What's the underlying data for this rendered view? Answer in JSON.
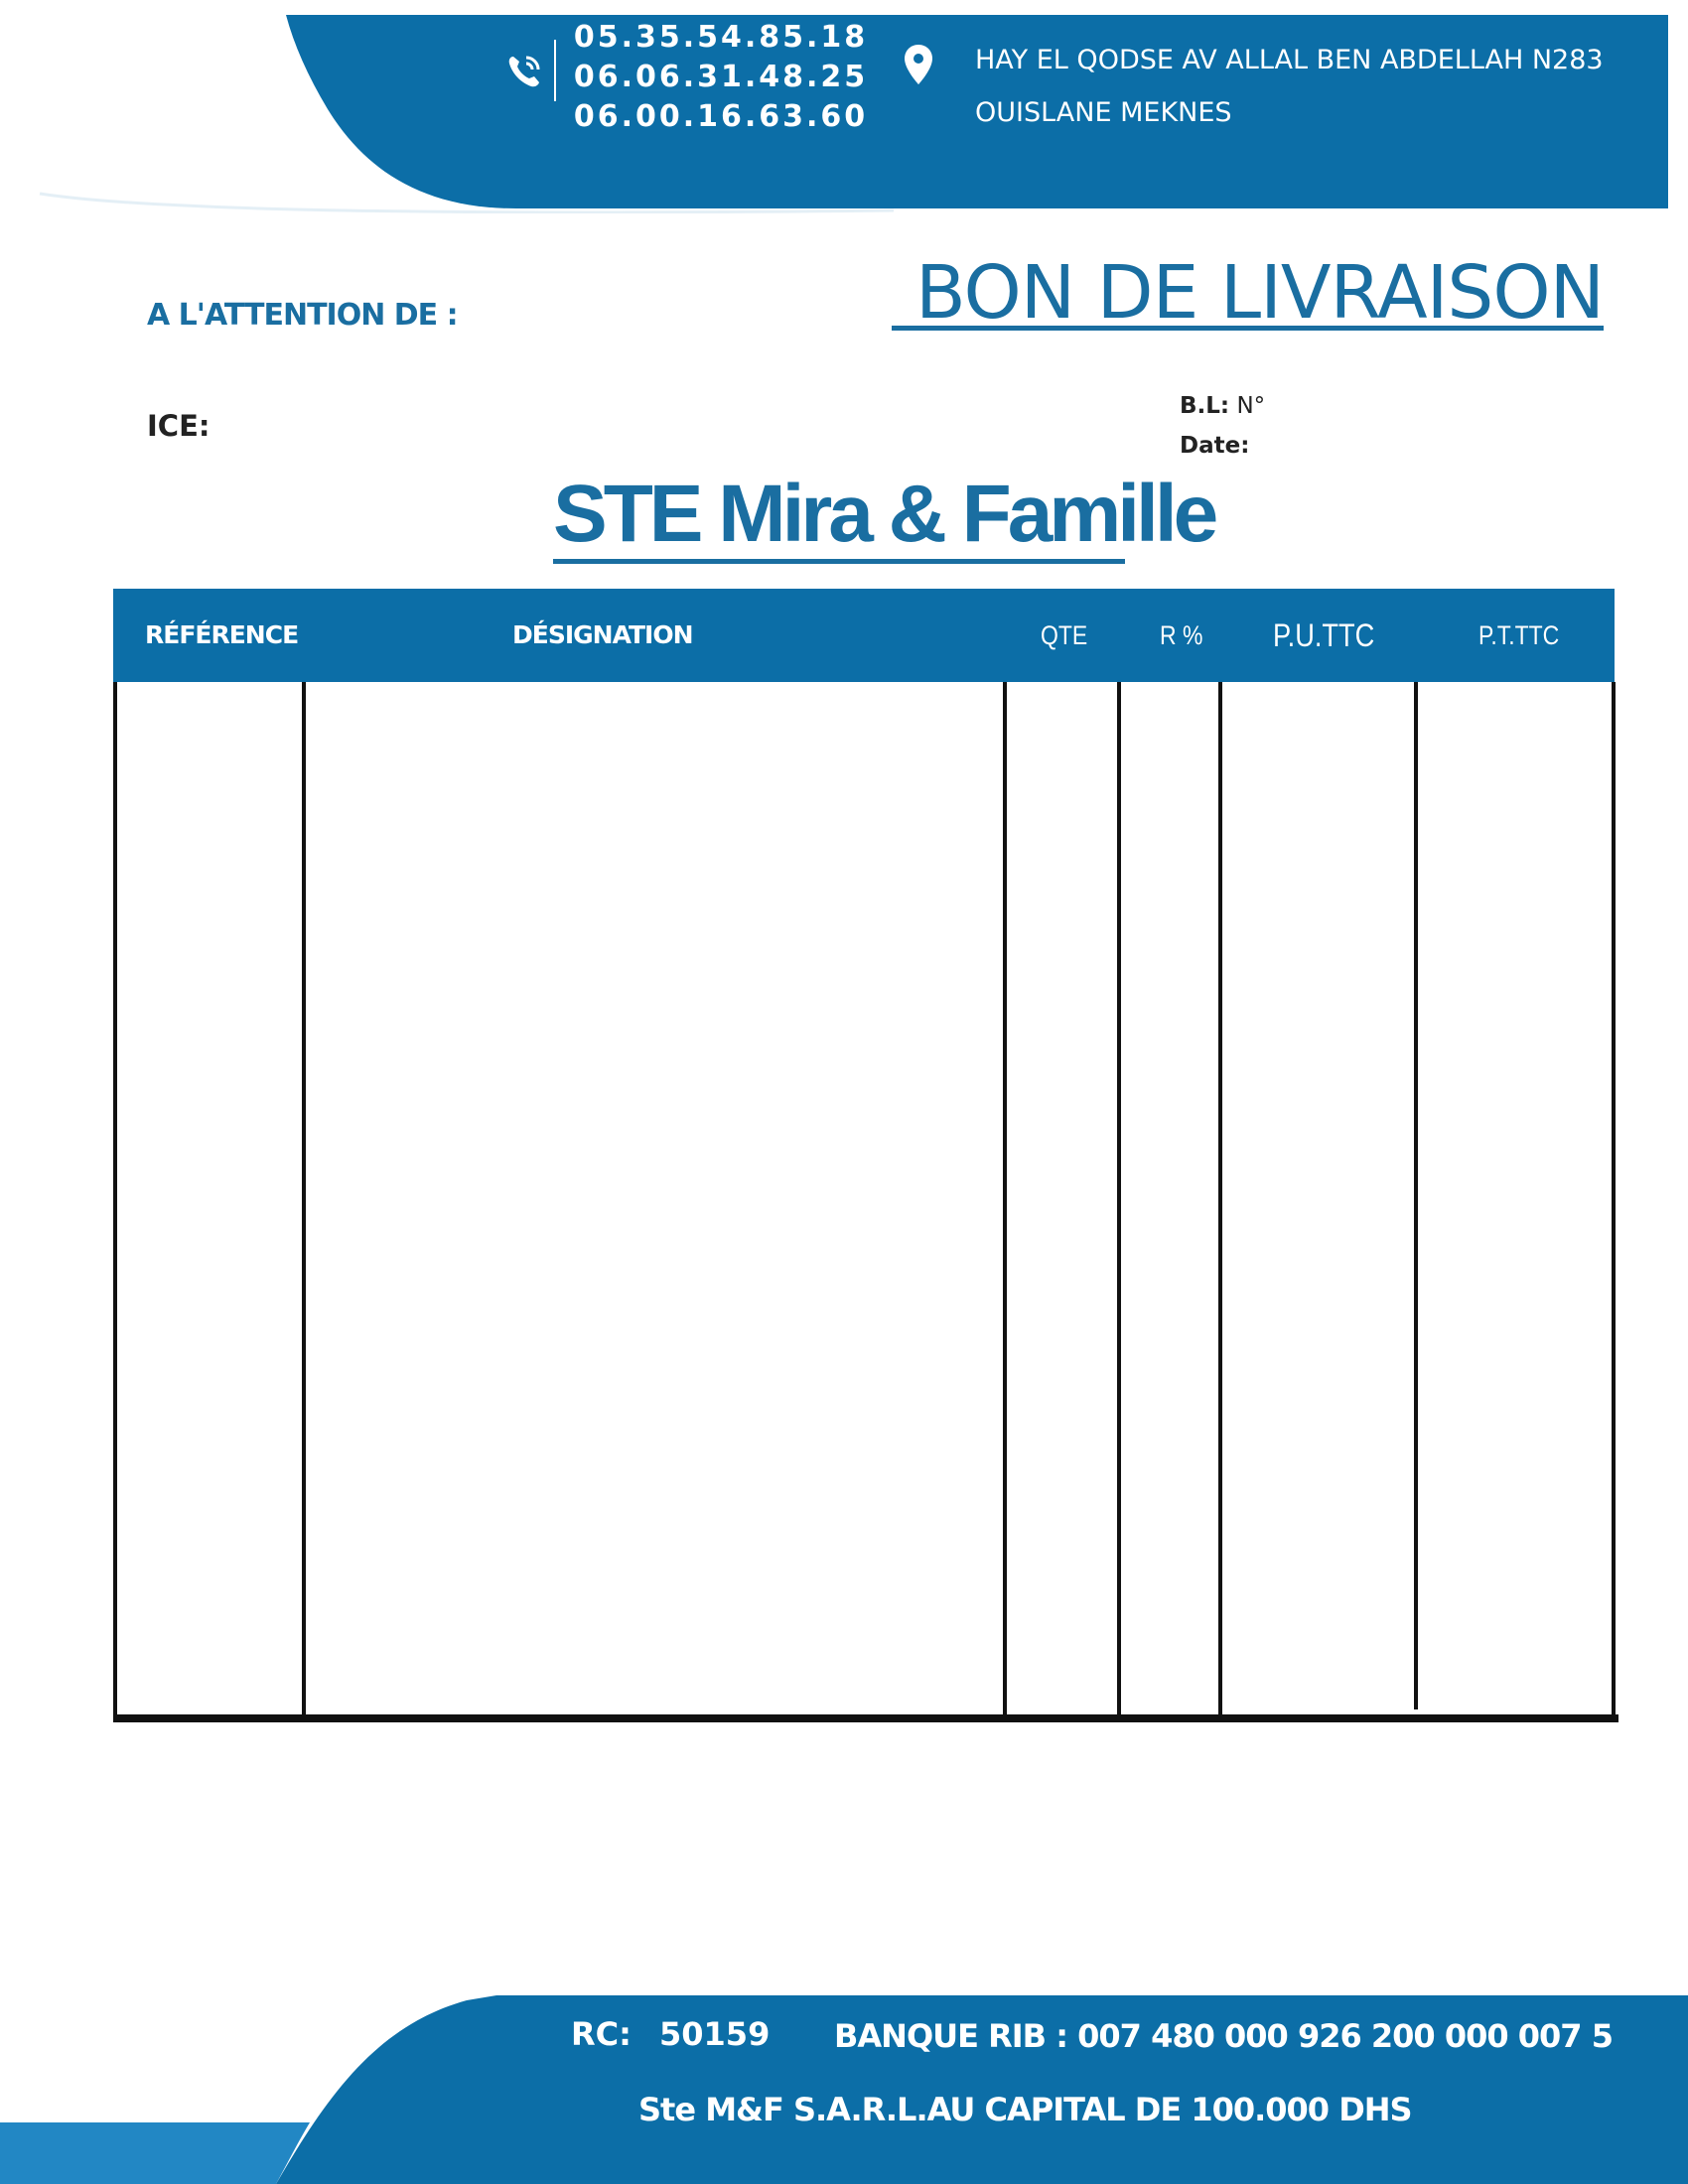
{
  "colors": {
    "brand_blue": "#0c6ea7",
    "title_blue": "#1a6ea1",
    "rule": "#111111"
  },
  "header": {
    "phones": [
      "05.35.54.85.18",
      "06.06.31.48.25",
      "06.00.16.63.60"
    ],
    "address_lines": [
      "HAY EL QODSE AV ALLAL BEN ABDELLAH N283",
      "OUISLANE MEKNES"
    ],
    "icons": [
      "phone-icon",
      "location-pin-icon"
    ]
  },
  "document": {
    "title": "BON DE LIVRAISON",
    "attention_label": "A L'ATTENTION DE :",
    "ice_label": "ICE:",
    "bl_label": "B.L:",
    "bl_number_label": "N°",
    "date_label": "Date:",
    "company_name": "STE Mira & Famille"
  },
  "table": {
    "columns": [
      "RÉFÉRENCE",
      "DÉSIGNATION",
      "QTE",
      "R %",
      "P.U.TTC",
      "P.T.TTC"
    ],
    "rows": []
  },
  "footer": {
    "rc_label": "RC:",
    "rc_value": "50159",
    "rib": "BANQUE RIB :  007 480 000 926 200 000 007 5",
    "legal": "Ste M&F S.A.R.L.AU  CAPITAL DE 100.000 DHS"
  }
}
